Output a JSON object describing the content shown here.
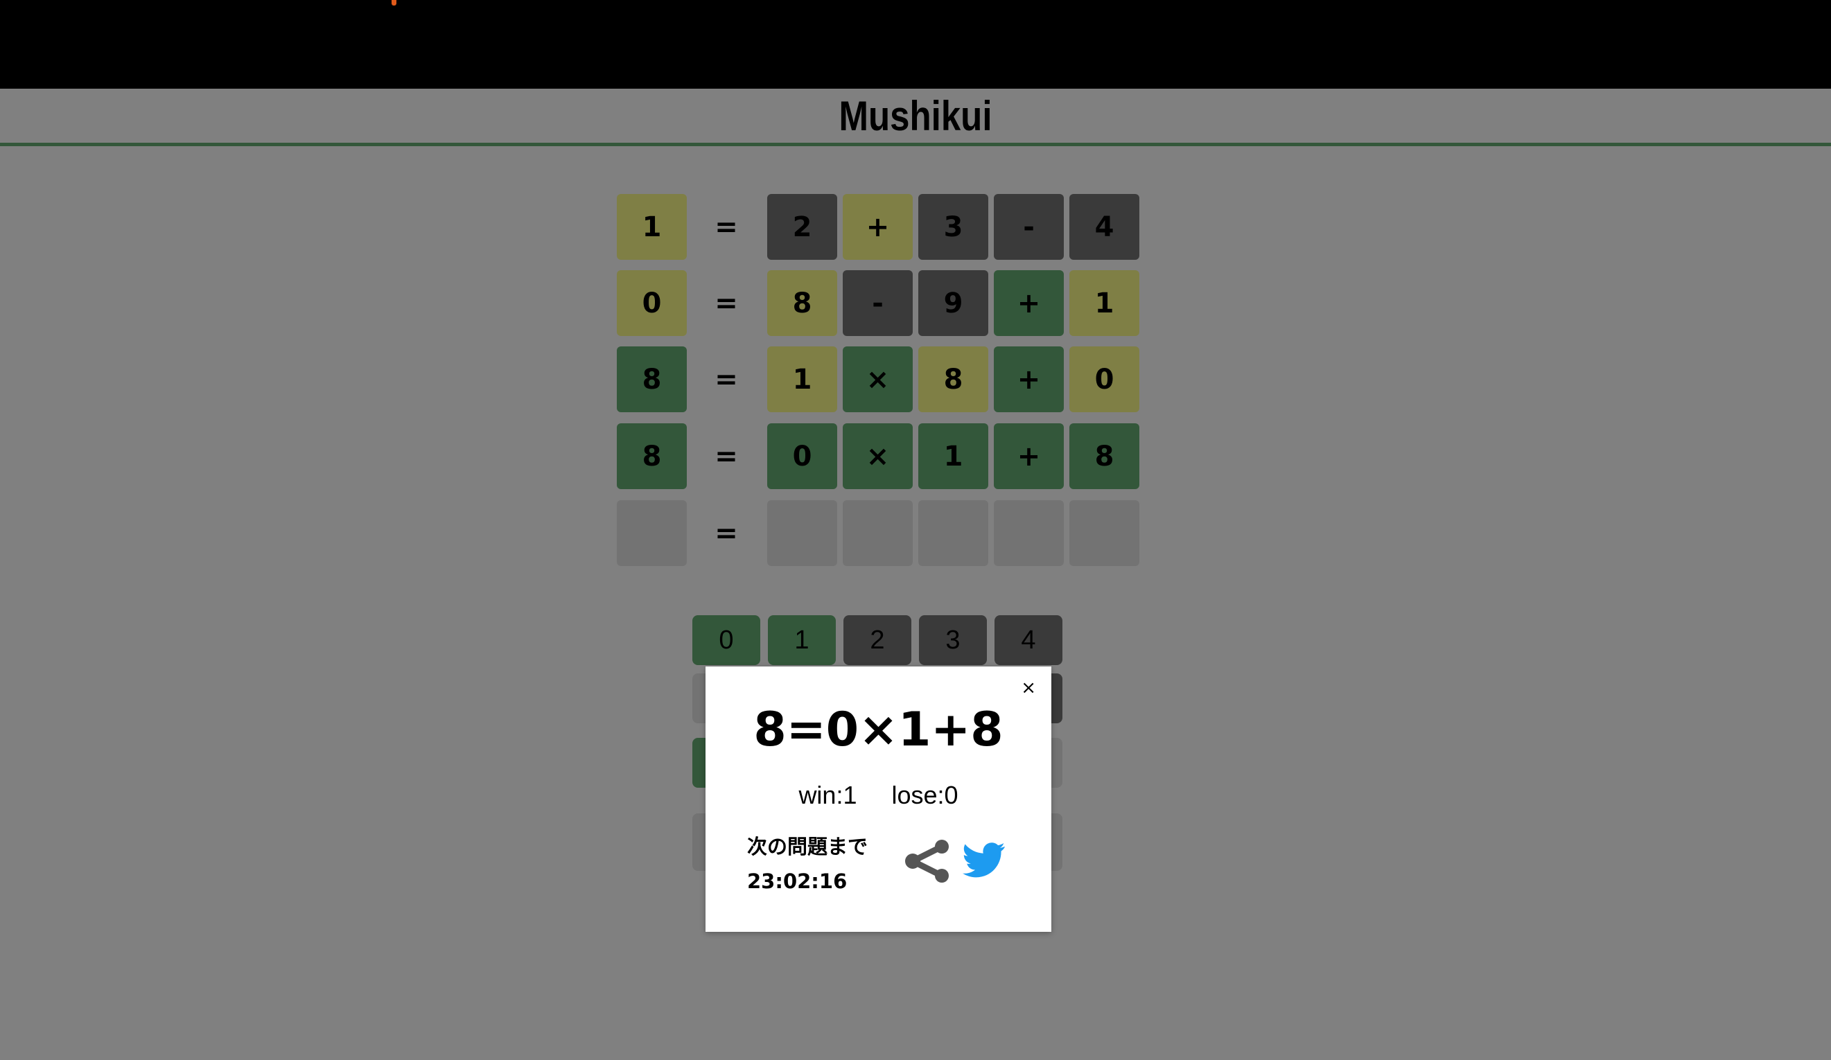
{
  "header": {
    "title": "Mushikui"
  },
  "colors": {
    "correct": "#33573a",
    "present": "#7f7f45",
    "absent": "#3a3a3a",
    "empty": "#737373",
    "twitter": "#1d9bf0"
  },
  "board": {
    "equals": "=",
    "rows": [
      [
        {
          "v": "1",
          "s": "present"
        },
        {
          "v": "2",
          "s": "absent"
        },
        {
          "v": "+",
          "s": "present"
        },
        {
          "v": "3",
          "s": "absent"
        },
        {
          "v": "-",
          "s": "absent"
        },
        {
          "v": "4",
          "s": "absent"
        }
      ],
      [
        {
          "v": "0",
          "s": "present"
        },
        {
          "v": "8",
          "s": "present"
        },
        {
          "v": "-",
          "s": "absent"
        },
        {
          "v": "9",
          "s": "absent"
        },
        {
          "v": "+",
          "s": "correct"
        },
        {
          "v": "1",
          "s": "present"
        }
      ],
      [
        {
          "v": "8",
          "s": "correct"
        },
        {
          "v": "1",
          "s": "present"
        },
        {
          "v": "×",
          "s": "correct"
        },
        {
          "v": "8",
          "s": "present"
        },
        {
          "v": "+",
          "s": "correct"
        },
        {
          "v": "0",
          "s": "present"
        }
      ],
      [
        {
          "v": "8",
          "s": "correct"
        },
        {
          "v": "0",
          "s": "correct"
        },
        {
          "v": "×",
          "s": "correct"
        },
        {
          "v": "1",
          "s": "correct"
        },
        {
          "v": "+",
          "s": "correct"
        },
        {
          "v": "8",
          "s": "correct"
        }
      ],
      [
        {
          "v": "",
          "s": "empty"
        },
        {
          "v": "",
          "s": "empty"
        },
        {
          "v": "",
          "s": "empty"
        },
        {
          "v": "",
          "s": "empty"
        },
        {
          "v": "",
          "s": "empty"
        },
        {
          "v": "",
          "s": "empty"
        }
      ]
    ]
  },
  "keyboard": {
    "rows": [
      [
        {
          "v": "0",
          "s": "correct"
        },
        {
          "v": "1",
          "s": "correct"
        },
        {
          "v": "2",
          "s": "absent"
        },
        {
          "v": "3",
          "s": "absent"
        },
        {
          "v": "4",
          "s": "absent"
        }
      ],
      [
        {
          "v": "",
          "s": "empty"
        },
        {
          "v": "",
          "s": "empty"
        },
        {
          "v": "",
          "s": "empty"
        },
        {
          "v": "",
          "s": "empty"
        },
        {
          "v": "",
          "s": "absent"
        }
      ],
      [
        {
          "v": "",
          "s": "correct"
        },
        {
          "v": "",
          "s": "empty"
        },
        {
          "v": "",
          "s": "empty"
        },
        {
          "v": "",
          "s": "empty"
        },
        {
          "v": "",
          "s": "empty"
        }
      ],
      [
        {
          "v": "",
          "s": "empty"
        },
        {
          "v": "",
          "s": "empty"
        },
        {
          "v": "",
          "s": "empty"
        },
        {
          "v": "",
          "s": "empty"
        },
        {
          "v": "",
          "s": "empty"
        }
      ]
    ]
  },
  "modal": {
    "close": "×",
    "answer": "8=0×1+8",
    "win": "win:1",
    "lose": "lose:0",
    "next_label": "次の問題まで",
    "countdown": "23:02:16",
    "share_icon": "share-icon",
    "twitter_icon": "twitter-icon"
  }
}
